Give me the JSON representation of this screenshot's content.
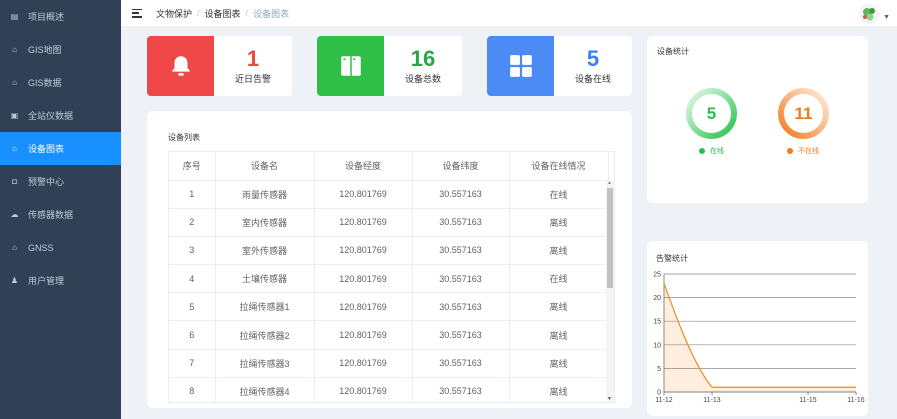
{
  "sidebar": {
    "items": [
      {
        "label": "项目概述",
        "icon": "dashboard-icon"
      },
      {
        "label": "GIS地图",
        "icon": "map-icon"
      },
      {
        "label": "GIS数据",
        "icon": "data-icon"
      },
      {
        "label": "全站仪数据",
        "icon": "instrument-icon"
      },
      {
        "label": "设备图表",
        "icon": "chart-icon",
        "active": true
      },
      {
        "label": "预警中心",
        "icon": "alert-icon"
      },
      {
        "label": "传感器数据",
        "icon": "sensor-icon"
      },
      {
        "label": "GNSS",
        "icon": "gnss-icon"
      },
      {
        "label": "用户管理",
        "icon": "user-icon"
      }
    ]
  },
  "header": {
    "breadcrumb": [
      "文物保护",
      "设备图表",
      "设备图表"
    ]
  },
  "stats": [
    {
      "value": "1",
      "label": "近日告警",
      "color": "#f04848",
      "num_color": "#e74c3c",
      "icon": "bell-icon"
    },
    {
      "value": "16",
      "label": "设备总数",
      "color": "#2fbf47",
      "num_color": "#28a745",
      "icon": "device-icon"
    },
    {
      "value": "5",
      "label": "设备在线",
      "color": "#4c8bf5",
      "num_color": "#3b7ff0",
      "icon": "grid-icon"
    }
  ],
  "device_list": {
    "title": "设备列表",
    "columns": [
      "序号",
      "设备名",
      "设备经度",
      "设备纬度",
      "设备在线情况"
    ],
    "rows": [
      [
        "1",
        "雨量传感器",
        "120.801769",
        "30.557163",
        "在线"
      ],
      [
        "2",
        "室内传感器",
        "120.801769",
        "30.557163",
        "离线"
      ],
      [
        "3",
        "室外传感器",
        "120.801769",
        "30.557163",
        "离线"
      ],
      [
        "4",
        "土壤传感器",
        "120.801769",
        "30.557163",
        "在线"
      ],
      [
        "5",
        "拉绳传感器1",
        "120.801769",
        "30.557163",
        "离线"
      ],
      [
        "6",
        "拉绳传感器2",
        "120.801769",
        "30.557163",
        "离线"
      ],
      [
        "7",
        "拉绳传感器3",
        "120.801769",
        "30.557163",
        "离线"
      ],
      [
        "8",
        "拉绳传感器4",
        "120.801769",
        "30.557163",
        "离线"
      ]
    ]
  },
  "device_stats": {
    "title": "设备统计",
    "online": {
      "value": "5",
      "label": "在线",
      "color": "#27c24c"
    },
    "offline": {
      "value": "11",
      "label": "不在线",
      "color": "#f27b20"
    }
  },
  "alarm_stats": {
    "title": "告警统计"
  },
  "chart_data": {
    "type": "area",
    "title": "告警统计",
    "x_ticks": [
      "11-12",
      "11-13",
      "11-15",
      "11-16"
    ],
    "x": [
      0,
      0.6,
      1,
      2,
      3,
      4
    ],
    "values": [
      23,
      10,
      1,
      1,
      1,
      1
    ],
    "ylim": [
      0,
      25
    ],
    "y_ticks": [
      0,
      5,
      10,
      15,
      20,
      25
    ],
    "color": "#f08a24"
  }
}
